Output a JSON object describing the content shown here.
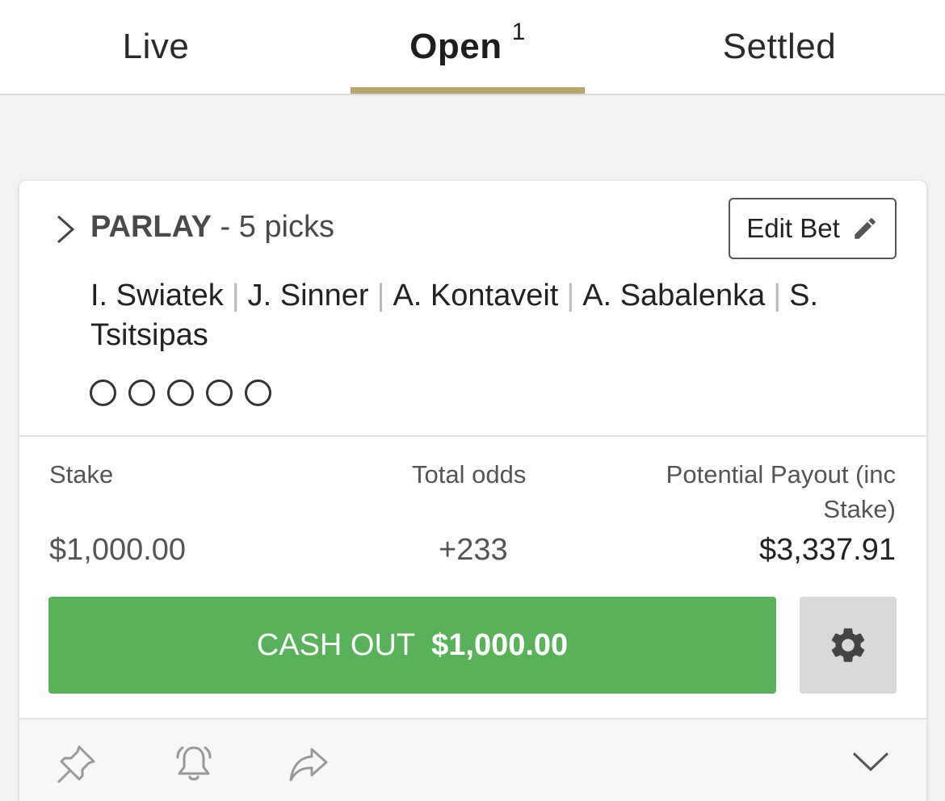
{
  "tabs": {
    "live": "Live",
    "open": "Open",
    "open_count": "1",
    "settled": "Settled"
  },
  "bet": {
    "type": "PARLAY",
    "picks_text": "- 5 picks",
    "edit_label": "Edit Bet",
    "selections": [
      "I. Swiatek",
      "J. Sinner",
      "A. Kontaveit",
      "A. Sabalenka",
      "S. Tsitsipas"
    ],
    "separator": "|",
    "stake_label": "Stake",
    "odds_label": "Total odds",
    "payout_label": "Potential Payout (inc Stake)",
    "stake_value": "$1,000.00",
    "odds_value": "+233",
    "payout_value": "$3,337.91",
    "cashout_label": "CASH OUT",
    "cashout_amount": "$1,000.00"
  },
  "icons": {
    "expand": "chevron-right-icon",
    "edit": "pencil-icon",
    "settings": "gear-icon",
    "pin": "pin-icon",
    "alert": "bell-icon",
    "share": "share-icon",
    "collapse": "chevron-down-icon"
  },
  "colors": {
    "tab_indicator": "#b8a46e",
    "cashout": "#59b25a",
    "settings_bg": "#d9d9d9"
  }
}
